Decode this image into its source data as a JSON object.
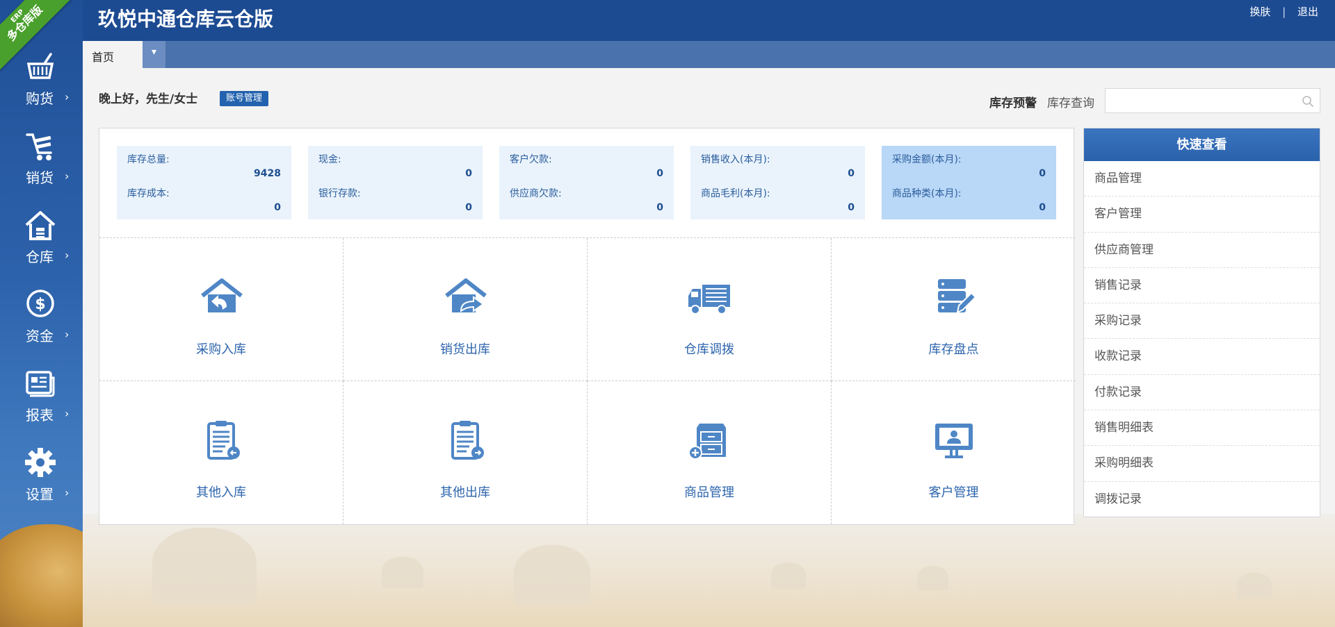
{
  "header": {
    "title": "玖悦中通仓库云仓版",
    "skin_label": "换肤",
    "separator": "|",
    "logout_label": "退出"
  },
  "ribbon": {
    "erp": "ERP",
    "text": "多仓库版"
  },
  "sidebar": {
    "items": [
      {
        "label": "购货",
        "icon": "basket-icon"
      },
      {
        "label": "销货",
        "icon": "cart-icon"
      },
      {
        "label": "仓库",
        "icon": "warehouse-icon"
      },
      {
        "label": "资金",
        "icon": "dollar-icon"
      },
      {
        "label": "报表",
        "icon": "report-icon"
      },
      {
        "label": "设置",
        "icon": "gear-icon"
      }
    ],
    "arrow": "›"
  },
  "tabs": {
    "home": "首页",
    "menu_arrow": "▾"
  },
  "greeting": {
    "text": "晚上好，先生/女士",
    "account_button": "账号管理"
  },
  "toolbar": {
    "stock_alert": "库存预警",
    "stock_query": "库存查询",
    "search_placeholder": ""
  },
  "stats": [
    {
      "k1": "库存总量:",
      "v1": "9428",
      "k2": "库存成本:",
      "v2": "0"
    },
    {
      "k1": "现金:",
      "v1": "0",
      "k2": "银行存款:",
      "v2": "0"
    },
    {
      "k1": "客户欠款:",
      "v1": "0",
      "k2": "供应商欠款:",
      "v2": "0"
    },
    {
      "k1": "销售收入(本月):",
      "v1": "0",
      "k2": "商品毛利(本月):",
      "v2": "0"
    },
    {
      "k1": "采购金额(本月):",
      "v1": "0",
      "k2": "商品种类(本月):",
      "v2": "0"
    }
  ],
  "tiles": [
    {
      "label": "采购入库",
      "icon": "house-in-icon"
    },
    {
      "label": "销货出库",
      "icon": "house-out-icon"
    },
    {
      "label": "仓库调拨",
      "icon": "truck-icon"
    },
    {
      "label": "库存盘点",
      "icon": "server-edit-icon"
    },
    {
      "label": "其他入库",
      "icon": "clipboard-in-icon"
    },
    {
      "label": "其他出库",
      "icon": "clipboard-out-icon"
    },
    {
      "label": "商品管理",
      "icon": "cabinet-add-icon"
    },
    {
      "label": "客户管理",
      "icon": "monitor-user-icon"
    }
  ],
  "quick_view": {
    "title": "快速查看",
    "items": [
      "商品管理",
      "客户管理",
      "供应商管理",
      "销售记录",
      "采购记录",
      "收款记录",
      "付款记录",
      "销售明细表",
      "采购明细表",
      "调拨记录"
    ]
  },
  "colors": {
    "header_bg": "#1d4b92",
    "tab_bar_bg": "#4a72ad",
    "accent": "#2c64ad",
    "stat_highlight": "#b9d7f7"
  }
}
